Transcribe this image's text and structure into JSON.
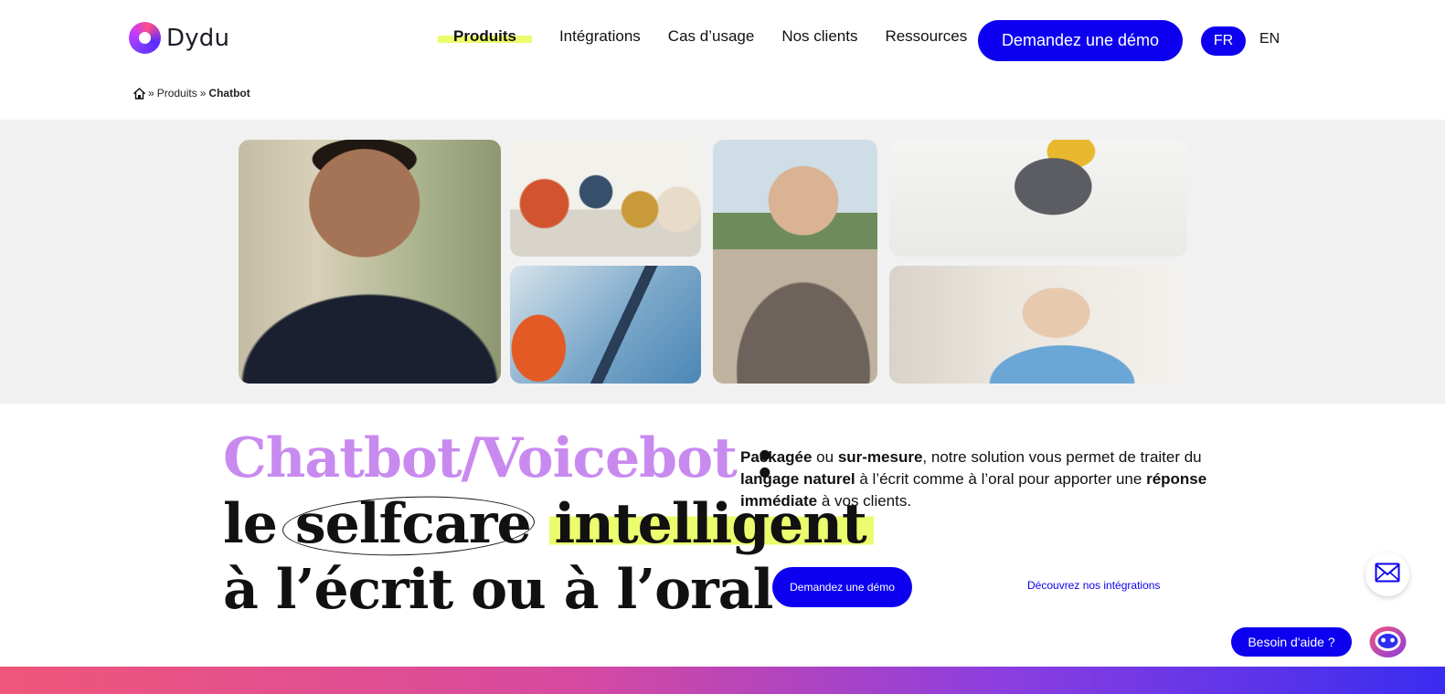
{
  "brand": {
    "name": "Dydu",
    "accent": "#0d00f0",
    "highlight": "#ebfc6e",
    "violet": "#c98af0"
  },
  "nav": {
    "items": [
      {
        "label": "Produits",
        "active": true
      },
      {
        "label": "Intégrations"
      },
      {
        "label": "Cas d’usage"
      },
      {
        "label": "Nos clients"
      },
      {
        "label": "Ressources"
      }
    ],
    "demo_button": "Demandez une démo",
    "lang_fr": "FR",
    "lang_en": "EN"
  },
  "breadcrumb": {
    "home_icon": "home-icon",
    "separator": "»",
    "items": [
      "Produits",
      "Chatbot"
    ]
  },
  "hero": {
    "title_part1": "Chatbot/Voicebot",
    "title_colon": " :",
    "title_le": "le",
    "title_selfcare": "selfcare",
    "title_intelligent": "intelligent",
    "title_line3": "à l’écrit ou à l’oral",
    "desc": {
      "b1": "Packagée",
      "t1": " ou ",
      "b2": "sur-mesure",
      "t2": ", notre solution vous permet de traiter du ",
      "b3": "langage naturel",
      "t3": " à l’écrit comme à l’oral pour apporter une ",
      "b4": "réponse immédiate",
      "t4": " à vos clients."
    },
    "demo_button": "Demandez une démo",
    "integrations_link": "Découvrez nos intégrations"
  },
  "widgets": {
    "mail_icon": "mail-icon",
    "help_label": "Besoin d'aide ?",
    "bot_icon": "chatbot-icon"
  }
}
